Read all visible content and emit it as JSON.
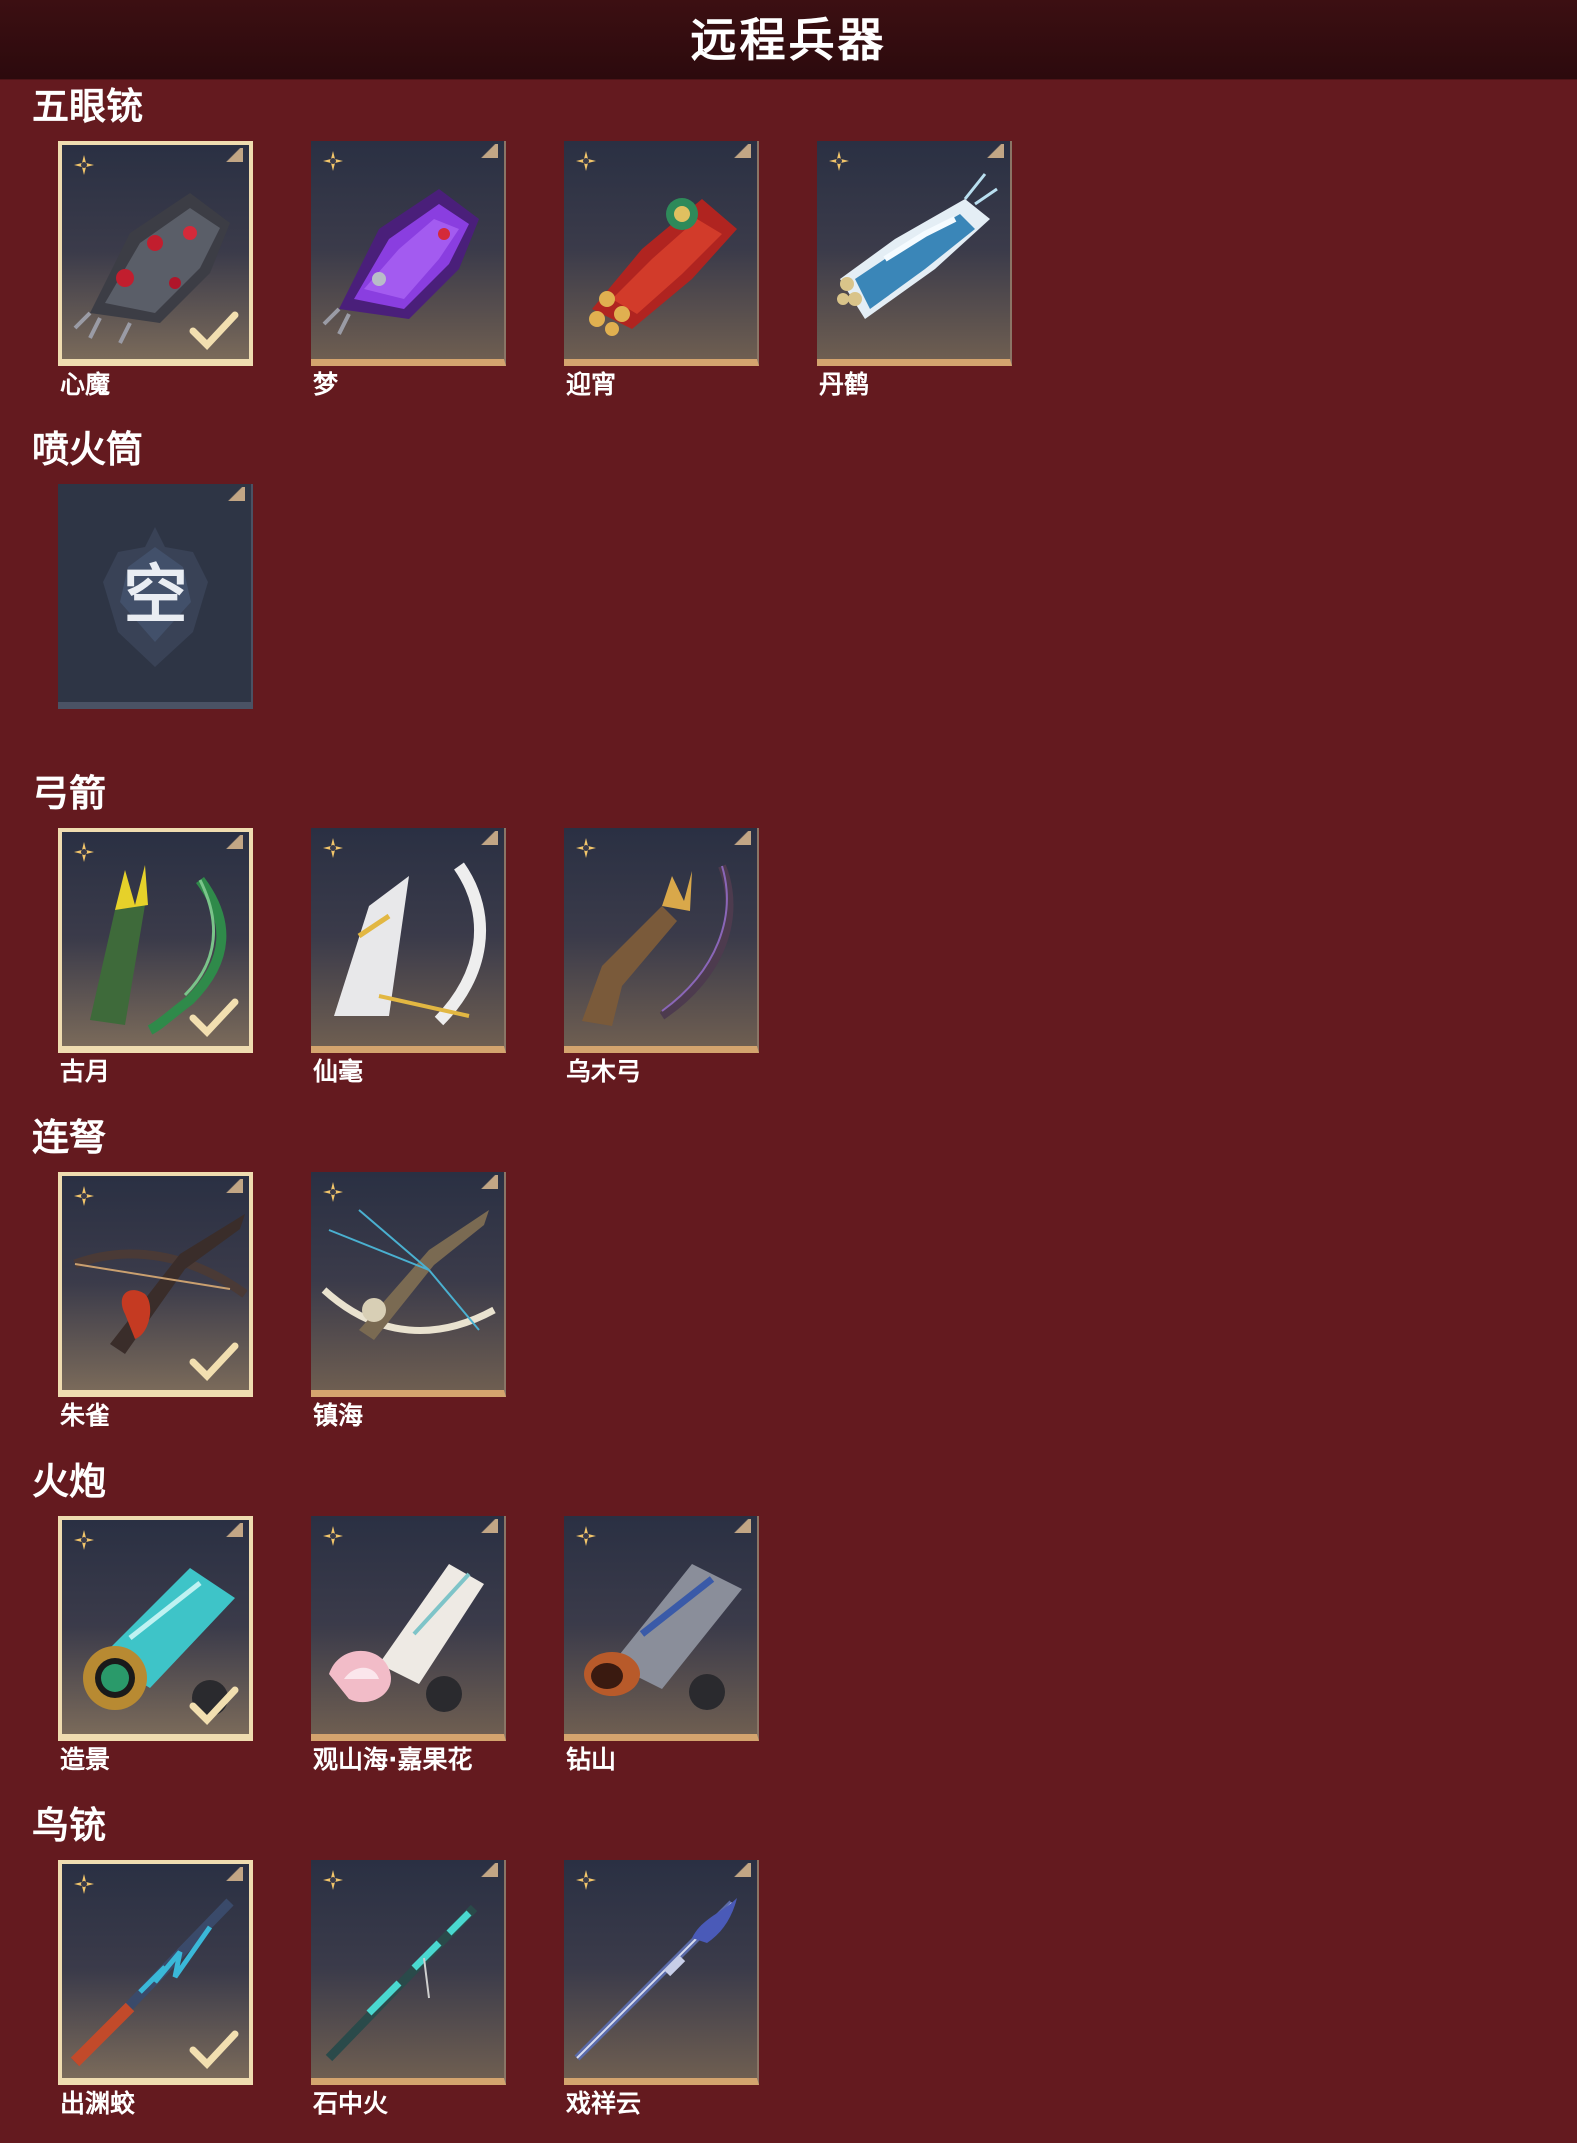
{
  "header": {
    "title": "远程兵器"
  },
  "colors": {
    "background": "#641a1f",
    "header": "#2c0a0d",
    "frame_gold": "#d4a46e",
    "selected_border": "#efdcb0",
    "empty_slot": "#2e3545"
  },
  "sections": [
    {
      "title": "五眼铳",
      "items": [
        {
          "name": "心魔",
          "equipped": true,
          "theme": "red-black"
        },
        {
          "name": "梦",
          "equipped": false,
          "theme": "purple"
        },
        {
          "name": "迎宵",
          "equipped": false,
          "theme": "red-gold"
        },
        {
          "name": "丹鹤",
          "equipped": false,
          "theme": "white-blue"
        }
      ]
    },
    {
      "title": "喷火筒",
      "items": [
        {
          "name": "",
          "empty": true,
          "empty_label": "空"
        }
      ]
    },
    {
      "title": "弓箭",
      "items": [
        {
          "name": "古月",
          "equipped": true,
          "theme": "green"
        },
        {
          "name": "仙毫",
          "equipped": false,
          "theme": "white"
        },
        {
          "name": "乌木弓",
          "equipped": false,
          "theme": "wood"
        }
      ]
    },
    {
      "title": "连弩",
      "items": [
        {
          "name": "朱雀",
          "equipped": true,
          "theme": "red-dark"
        },
        {
          "name": "镇海",
          "equipped": false,
          "theme": "bone"
        }
      ]
    },
    {
      "title": "火炮",
      "items": [
        {
          "name": "造景",
          "equipped": true,
          "theme": "teal-gold"
        },
        {
          "name": "观山海·嘉果花",
          "equipped": false,
          "theme": "pink-white"
        },
        {
          "name": "钻山",
          "equipped": false,
          "theme": "silver-blue"
        }
      ]
    },
    {
      "title": "鸟铳",
      "items": [
        {
          "name": "出渊蛟",
          "equipped": true,
          "theme": "teal-red"
        },
        {
          "name": "石中火",
          "equipped": false,
          "theme": "teal"
        },
        {
          "name": "戏祥云",
          "equipped": false,
          "theme": "blue-silver"
        }
      ]
    }
  ]
}
